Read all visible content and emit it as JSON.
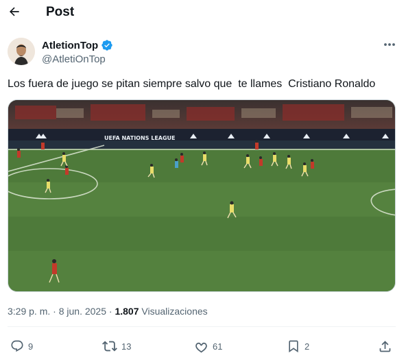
{
  "header": {
    "title": "Post"
  },
  "author": {
    "display_name": "AtletionTop",
    "handle": "@AtletiOnTop",
    "verified": true
  },
  "post": {
    "text": "Los fuera de juego se pitan siempre salvo que  te llames  Cristiano Ronaldo"
  },
  "media": {
    "board_text": "UEFA NATIONS LEAGUE",
    "pitch_color": "#4e7a3a"
  },
  "meta": {
    "time": "3:29 p. m.",
    "separator": "·",
    "date": "8 jun. 2025",
    "views_count": "1.807",
    "views_label": "Visualizaciones"
  },
  "actions": {
    "replies": "9",
    "reposts": "13",
    "likes": "61",
    "bookmarks": "2"
  },
  "colors": {
    "text_primary": "#0f1419",
    "text_secondary": "#536471",
    "verified_badge": "#1d9bf0",
    "border": "#eff3f4"
  }
}
